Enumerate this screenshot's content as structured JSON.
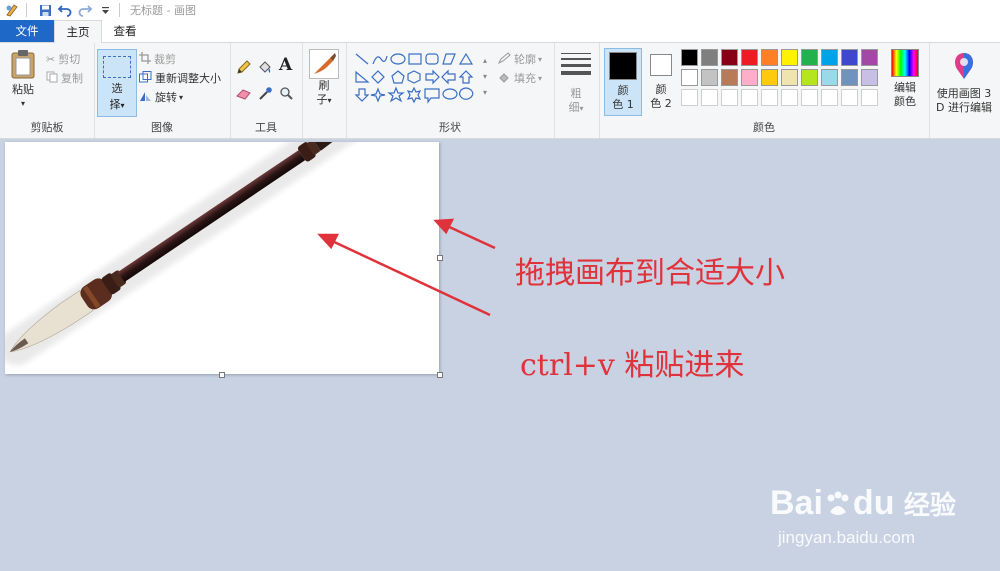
{
  "window": {
    "title": "无标题 - 画图"
  },
  "tabs": {
    "file": "文件",
    "home": "主页",
    "view": "查看"
  },
  "clipboard": {
    "paste": "粘贴",
    "cut": "剪切",
    "copy": "复制",
    "group": "剪贴板"
  },
  "image": {
    "select_line1": "选",
    "select_line2": "择",
    "crop": "裁剪",
    "resize": "重新调整大小",
    "rotate": "旋转",
    "group": "图像"
  },
  "tools": {
    "group": "工具"
  },
  "brush": {
    "line1": "刷",
    "line2": "子"
  },
  "shapes": {
    "outline": "轮廓",
    "fill": "填充",
    "group": "形状"
  },
  "size": {
    "line1": "粗",
    "line2": "细"
  },
  "colors": {
    "color1_line1": "颜",
    "color1_line2": "色 1",
    "color2_line1": "颜",
    "color2_line2": "色 2",
    "edit_line1": "编辑",
    "edit_line2": "颜色",
    "group": "颜色",
    "color1": "#000000",
    "color2": "#ffffff",
    "palette_row1": [
      "#000000",
      "#7f7f7f",
      "#880015",
      "#ed1c24",
      "#ff7f27",
      "#fff200",
      "#22b14c",
      "#00a2e8",
      "#3f48cc",
      "#a349a4"
    ],
    "palette_row2": [
      "#ffffff",
      "#c3c3c3",
      "#b97a57",
      "#ffaec9",
      "#ffc90e",
      "#efe4b0",
      "#b5e61d",
      "#99d9ea",
      "#7092be",
      "#c8bfe7"
    ]
  },
  "paint3d": {
    "line1": "使用画图 3",
    "line2": "D 进行编辑"
  },
  "annotations": {
    "drag": "拖拽画布到合适大小",
    "paste": "ctrl+v 粘贴进来"
  },
  "watermark": {
    "brand_bai": "Bai",
    "brand_du": "du",
    "brand_cn": "经验",
    "url": "jingyan.baidu.com"
  }
}
